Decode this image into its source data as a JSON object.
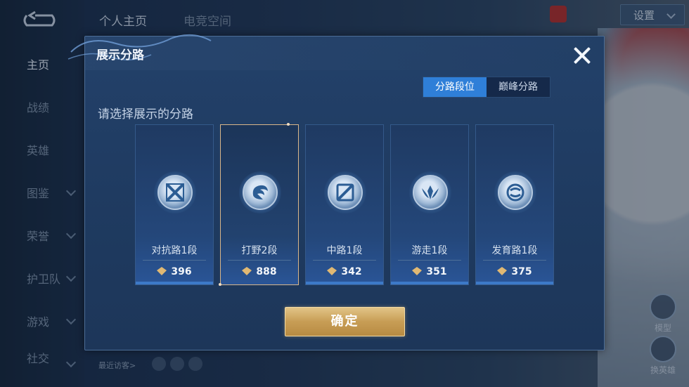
{
  "nav": {
    "items": [
      {
        "label": "主页"
      },
      {
        "label": "战绩"
      },
      {
        "label": "英雄"
      },
      {
        "label": "图鉴"
      },
      {
        "label": "荣誉"
      },
      {
        "label": "护卫队"
      },
      {
        "label": "游戏"
      },
      {
        "label": "社交"
      }
    ]
  },
  "top_tabs": [
    "个人主页",
    "电竞空间"
  ],
  "settings_label": "设置",
  "bottom": {
    "recent_visitors": "最近访客>"
  },
  "side": {
    "model_label": "模型",
    "hero_label": "换英雄"
  },
  "modal": {
    "title": "展示分路",
    "segment": [
      "分路段位",
      "巅峰分路"
    ],
    "segment_active": 0,
    "prompt": "请选择展示的分路",
    "confirm_label": "确定",
    "cards": [
      {
        "label": "对抗路1段",
        "score": "396",
        "icon": "clash-lane-icon",
        "selected": false
      },
      {
        "label": "打野2段",
        "score": "888",
        "icon": "jungle-icon",
        "selected": true
      },
      {
        "label": "中路1段",
        "score": "342",
        "icon": "mid-lane-icon",
        "selected": false
      },
      {
        "label": "游走1段",
        "score": "351",
        "icon": "roam-icon",
        "selected": false
      },
      {
        "label": "发育路1段",
        "score": "375",
        "icon": "farm-lane-icon",
        "selected": false
      }
    ]
  },
  "colors": {
    "accent": "#2f7fd8",
    "selected_border": "#d9b68a",
    "confirm": "#c79d55"
  }
}
